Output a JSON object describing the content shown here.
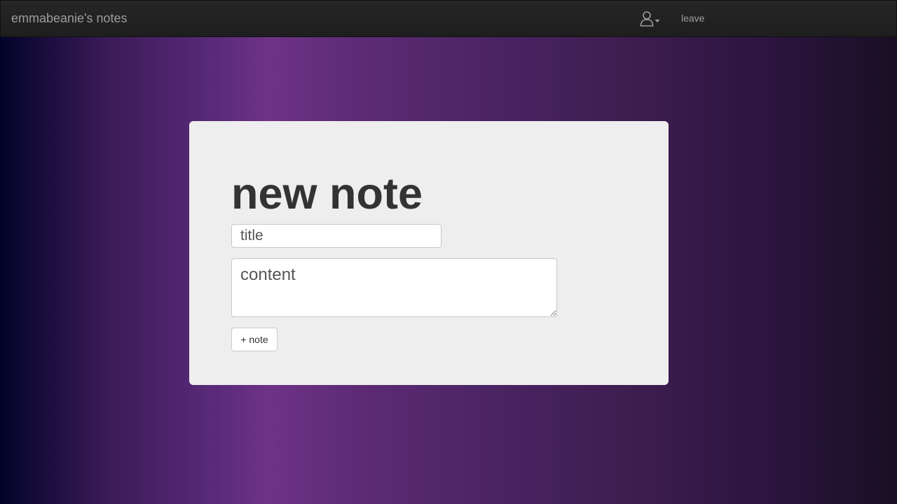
{
  "navbar": {
    "brand": "emmabeanie's notes",
    "user_menu_icon": "user-outline-icon",
    "user_menu_caret_icon": "caret-down-icon",
    "leave_label": "leave"
  },
  "form": {
    "heading": "new note",
    "title_placeholder": "title",
    "content_placeholder": "content",
    "submit_label": "+ note"
  },
  "colors": {
    "navbar_bg": "#222222",
    "nav_text": "#9d9d9d",
    "panel_bg": "#eeeeee",
    "heading_text": "#333333",
    "bg_purple": "#6e3286"
  }
}
